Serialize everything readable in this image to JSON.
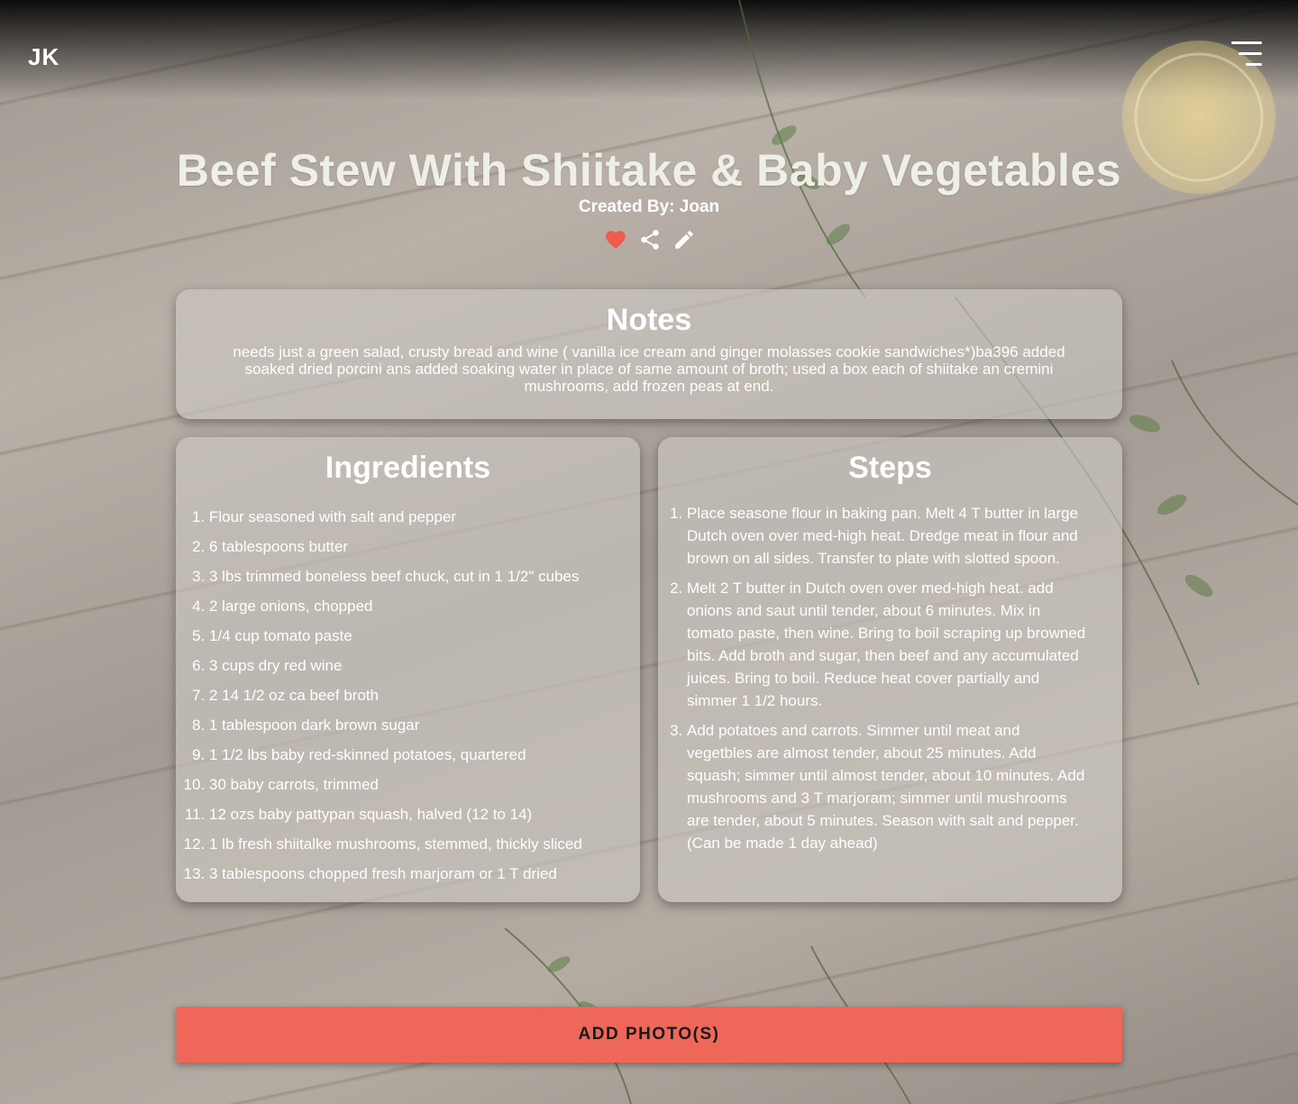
{
  "header": {
    "brand": "JK",
    "menu_icon": "hamburger-menu-icon"
  },
  "recipe": {
    "title": "Beef Stew With Shiitake & Baby Vegetables",
    "created_by": "Created By: Joan",
    "actions": {
      "favorite_icon": "heart-icon",
      "share_icon": "share-icon",
      "edit_icon": "pencil-icon"
    }
  },
  "notes": {
    "heading": "Notes",
    "text": "needs just a green salad, crusty bread and wine ( vanilla ice cream and ginger molasses cookie sandwiches*)ba396 added soaked dried porcini ans added soaking water in place of same amount of broth; used a box each of shiitake an cremini mushrooms, add frozen peas at end."
  },
  "ingredients": {
    "heading": "Ingredients",
    "items": [
      "Flour seasoned with salt and pepper",
      "6 tablespoons butter",
      "3 lbs trimmed boneless beef chuck, cut in 1 1/2\" cubes",
      "2 large onions, chopped",
      "1/4 cup tomato paste",
      "3 cups dry red wine",
      "2 14 1/2 oz ca beef broth",
      "1 tablespoon dark brown sugar",
      "1 1/2 lbs baby red-skinned potatoes, quartered",
      "30 baby carrots, trimmed",
      "12 ozs baby pattypan squash, halved (12 to 14)",
      "1 lb fresh shiitalke mushrooms, stemmed, thickly sliced",
      "3 tablespoons chopped fresh marjoram or 1 T dried"
    ]
  },
  "steps": {
    "heading": "Steps",
    "items": [
      "Place seasone flour in baking pan. Melt 4 T butter in large Dutch oven over med-high heat. Dredge meat in flour and brown on all sides. Transfer to plate with slotted spoon.",
      "Melt 2 T butter in Dutch oven over med-high heat. add onions and saut until tender, about 6 minutes. Mix in tomato paste, then wine. Bring to boil scraping up browned bits. Add broth and sugar, then beef and any accumulated juices. Bring to boil. Reduce heat cover partially and simmer 1 1/2 hours.",
      "Add potatoes and carrots. Simmer until meat and vegetbles are almost tender, about 25 minutes. Add squash; simmer until almost tender, about 10 minutes. Add mushrooms and 3 T marjoram; simmer until mushrooms are tender, about 5 minutes. Season with salt and pepper. (Can be made 1 day ahead)"
    ]
  },
  "add_photo_button": "ADD PHOTO(S)",
  "colors": {
    "accent": "#ee6759",
    "heart": "#f05a4f",
    "title": "#eef0e8"
  }
}
